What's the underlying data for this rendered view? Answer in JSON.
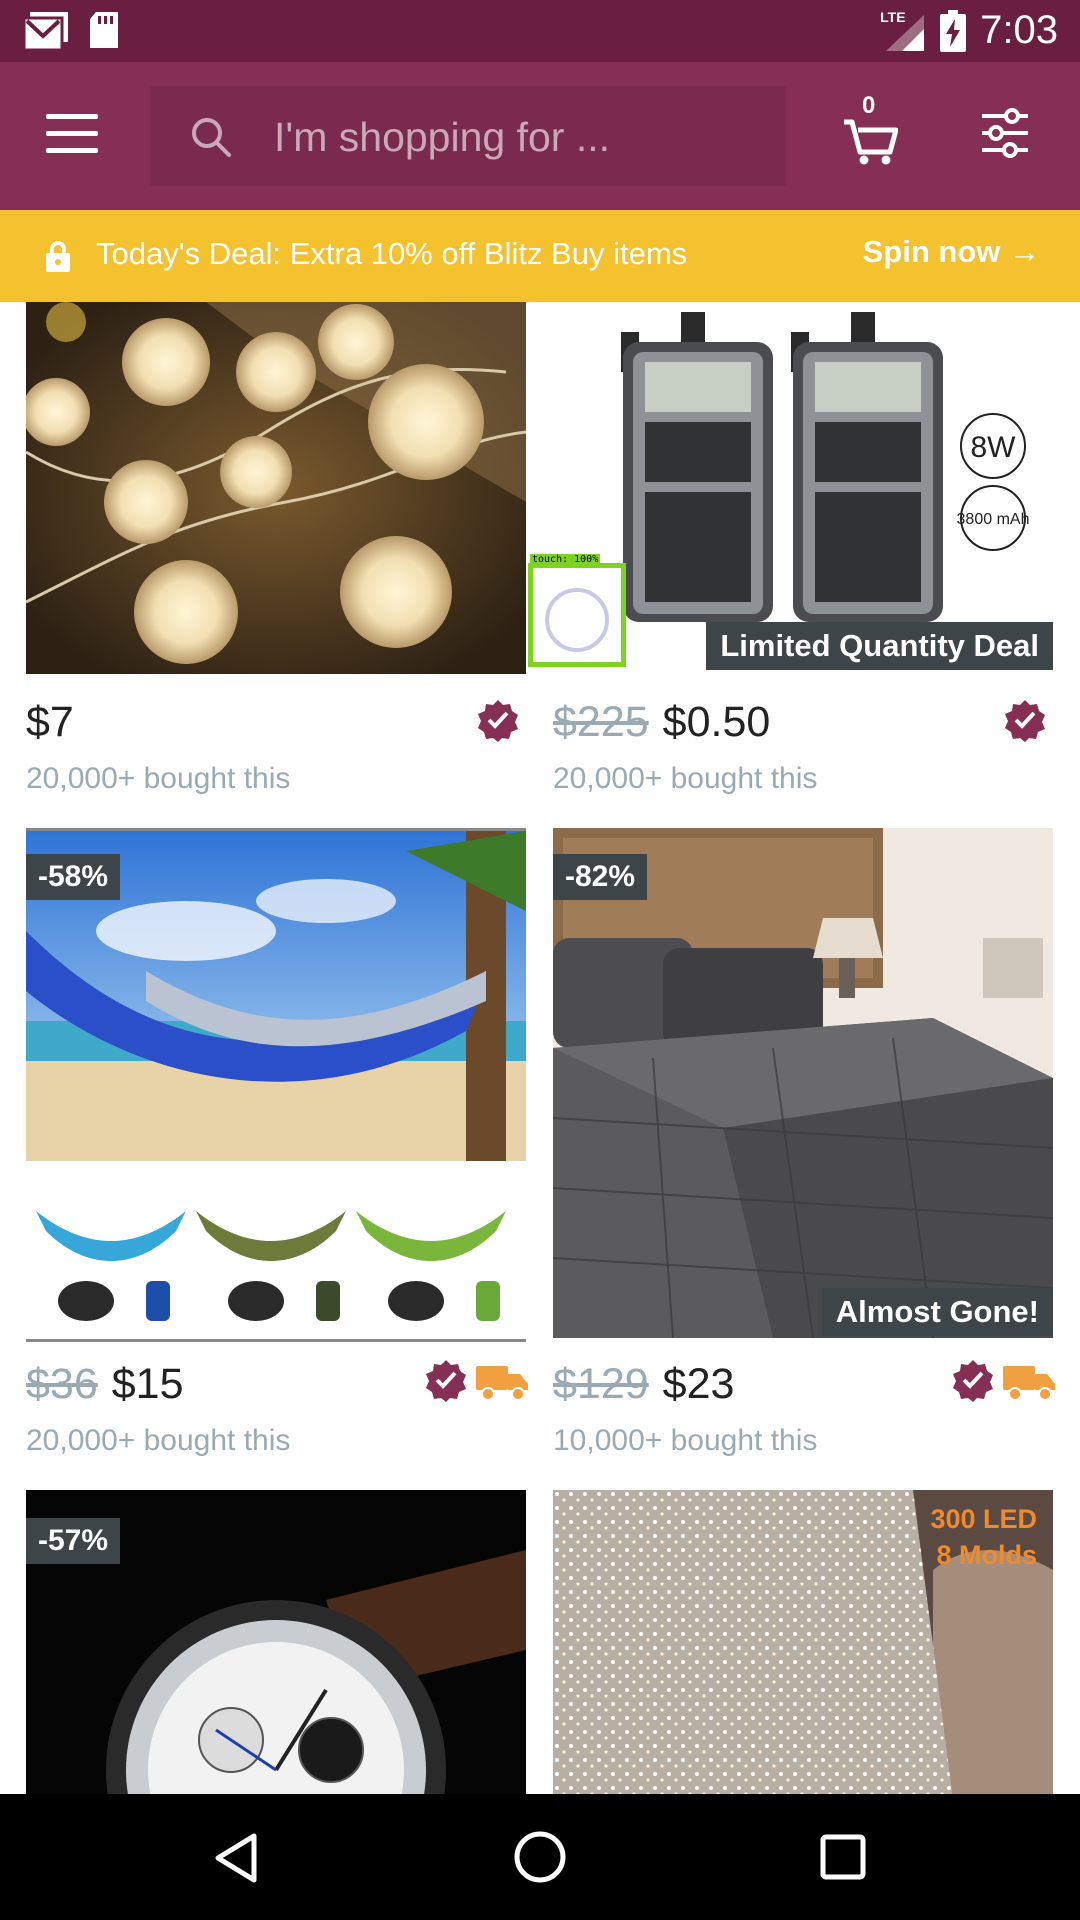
{
  "status_bar": {
    "time": "7:03",
    "network": "LTE",
    "icons": [
      "gmail-icon",
      "sd-card-icon",
      "signal-icon",
      "battery-charging-icon"
    ]
  },
  "header": {
    "menu_icon": "hamburger-icon",
    "search_placeholder": "I'm shopping for ...",
    "cart_count": "0",
    "cart_icon": "cart-icon",
    "filter_icon": "filter-sliders-icon"
  },
  "deal_banner": {
    "text": "Today's Deal: Extra 10% off Blitz Buy items",
    "cta": "Spin now →"
  },
  "products": [
    {
      "image": "rose fairy lights",
      "price": "$7",
      "old_price": "",
      "bought": "20,000+ bought this",
      "verified": true,
      "fast_shipping": false,
      "discount": "",
      "tag": ""
    },
    {
      "image": "two-way radios",
      "price": "$0.50",
      "old_price": "$225",
      "bought": "20,000+ bought this",
      "verified": true,
      "fast_shipping": false,
      "discount": "",
      "tag": "Limited Quantity Deal",
      "image_text": [
        "8W",
        "3800 mAh"
      ]
    },
    {
      "image": "hammock",
      "price": "$15",
      "old_price": "$36",
      "bought": "20,000+ bought this",
      "verified": true,
      "fast_shipping": true,
      "discount": "-58%",
      "tag": ""
    },
    {
      "image": "grey comforter bedding",
      "price": "$23",
      "old_price": "$129",
      "bought": "10,000+ bought this",
      "verified": true,
      "fast_shipping": true,
      "discount": "-82%",
      "tag": "Almost Gone!"
    },
    {
      "image": "chronograph watch",
      "discount": "-57%"
    },
    {
      "image": "curtain lights",
      "image_text": [
        "300 LED",
        "8 Molds"
      ]
    }
  ],
  "touch_indicator": "touch: 100%",
  "colors": {
    "status_bar": "#6b1f40",
    "header": "#862f55",
    "deal_banner": "#f4c12f",
    "verified": "#862f55",
    "shipping": "#f0a040"
  }
}
